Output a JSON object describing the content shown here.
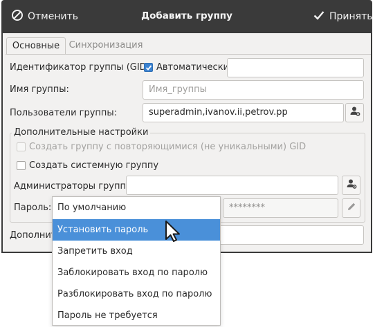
{
  "dialog": {
    "title": "Добавить группу",
    "cancel_label": "Отменить",
    "accept_label": "Принять"
  },
  "tabs": [
    {
      "label": "Основные",
      "active": true
    },
    {
      "label": "Синхронизация",
      "active": false
    }
  ],
  "form": {
    "gid_label": "Идентификатор группы (GID):",
    "gid_auto_label": "Автоматически",
    "gid_auto_checked": true,
    "gid_value": "",
    "name_label": "Имя группы:",
    "name_placeholder": "Имя_группы",
    "users_label": "Пользователи группы:",
    "users_value": "superadmin,ivanov.ii,petrov.pp",
    "extra_group_title": "Дополнительные настройки",
    "nonunique_label": "Создать группу с повторяющимися (не уникальными) GID",
    "nonunique_checked": false,
    "system_label": "Создать системную группу",
    "system_checked": false,
    "admins_label": "Администраторы группы:",
    "admins_value": "",
    "password_label": "Пароль:",
    "password_mode": "По умолчанию",
    "password_mask": "********",
    "extra_label": "Дополнит",
    "extra_value": ""
  },
  "password_menu": {
    "items": [
      {
        "label": "Установить пароль",
        "selected": true
      },
      {
        "label": "Запретить вход",
        "selected": false
      },
      {
        "label": "Заблокировать вход по паролю",
        "selected": false
      },
      {
        "label": "Разблокировать вход по паролю",
        "selected": false
      },
      {
        "label": "Пароль не требуется",
        "selected": false
      }
    ]
  },
  "icons": {
    "cancel": "cancel-circle-icon",
    "accept": "checkmark-icon",
    "user_select": "user-gear-icon",
    "edit": "pencil-icon",
    "cursor": "mouse-pointer-icon"
  },
  "colors": {
    "titlebar": "#3a3a3a",
    "selection": "#4a90d9",
    "checkbox_on": "#3b82d0"
  }
}
